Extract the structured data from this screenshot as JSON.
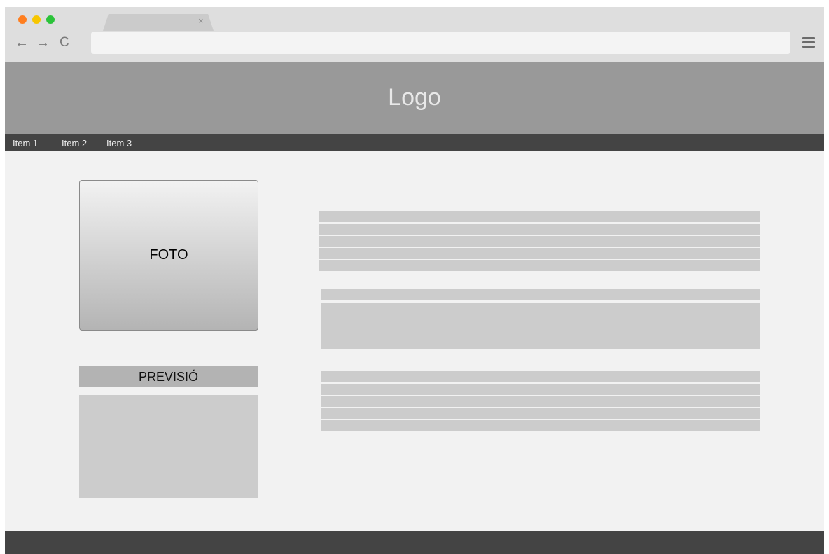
{
  "browser": {
    "tab_close_glyph": "×",
    "back_glyph": "←",
    "forward_glyph": "→",
    "reload_glyph": "C",
    "address": "",
    "traffic_lights": [
      "#ff7e1f",
      "#f7c600",
      "#2bc33a"
    ]
  },
  "header": {
    "logo": "Logo"
  },
  "nav": {
    "items": [
      "Item 1",
      "Item 2",
      "Item 3"
    ]
  },
  "photo": {
    "label": "FOTO"
  },
  "forecast": {
    "title": "PREVISIÓ"
  },
  "colors": {
    "header_bg": "#999999",
    "navbar_bg": "#444444",
    "content_bg": "#f2f2f2",
    "placeholder": "#cccccc",
    "footer_bg": "#444444"
  },
  "icons": {
    "close": "close-icon",
    "back": "back-arrow-icon",
    "forward": "forward-arrow-icon",
    "reload": "reload-icon",
    "menu": "hamburger-menu-icon"
  }
}
